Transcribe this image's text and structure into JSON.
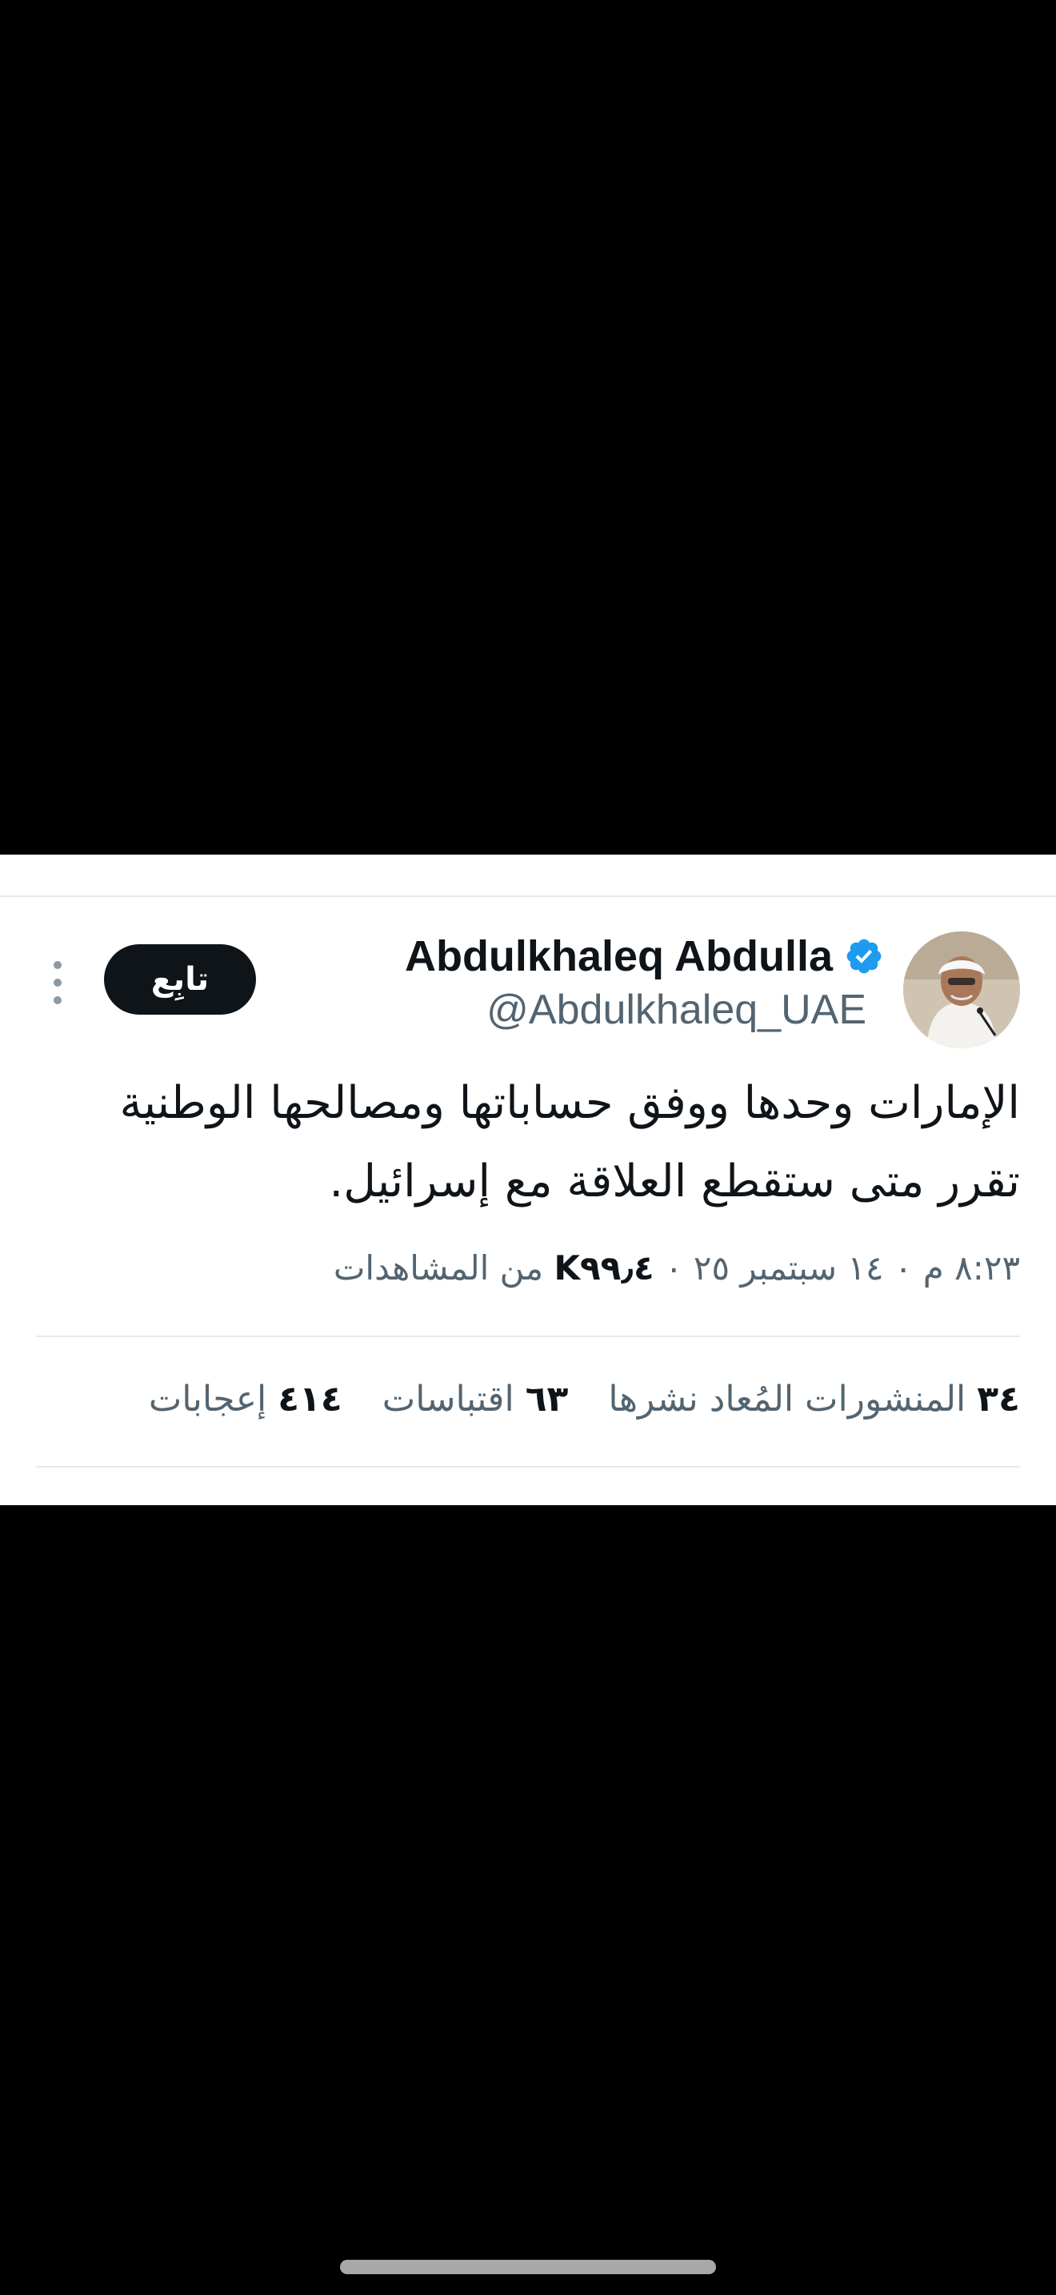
{
  "tweet": {
    "author": {
      "display_name": "Abdulkhaleq Abdulla",
      "handle": "@Abdulkhaleq_UAE",
      "verified_icon": "verified-badge-icon",
      "verified_color": "#1d9bf0"
    },
    "follow_label": "تابِع",
    "more_icon": "more-vertical-icon",
    "text_lines": [
      "الإمارات وحدها ووفق حساباتها ومصالحها الوطنية",
      "تقرر متى ستقطع العلاقة مع إسرائيل."
    ],
    "meta": {
      "time_date": "٨:٢٣ م ٠ ١٤ سبتمبر ٢٥ ٠ ",
      "views_count": "K٩٩٫٤",
      "views_label": " من المشاهدات"
    },
    "stats": [
      {
        "count": "٣٤",
        "label": "المنشورات المُعاد نشرها"
      },
      {
        "count": "٦٣",
        "label": "اقتباسات"
      },
      {
        "count": "٤١٤",
        "label": "إعجابات"
      }
    ]
  },
  "colors": {
    "background": "#000000",
    "card": "#ffffff",
    "text_primary": "#0f1419",
    "text_secondary": "#536471",
    "divider": "#e6e9ec",
    "follow_button": "#0f1419"
  }
}
